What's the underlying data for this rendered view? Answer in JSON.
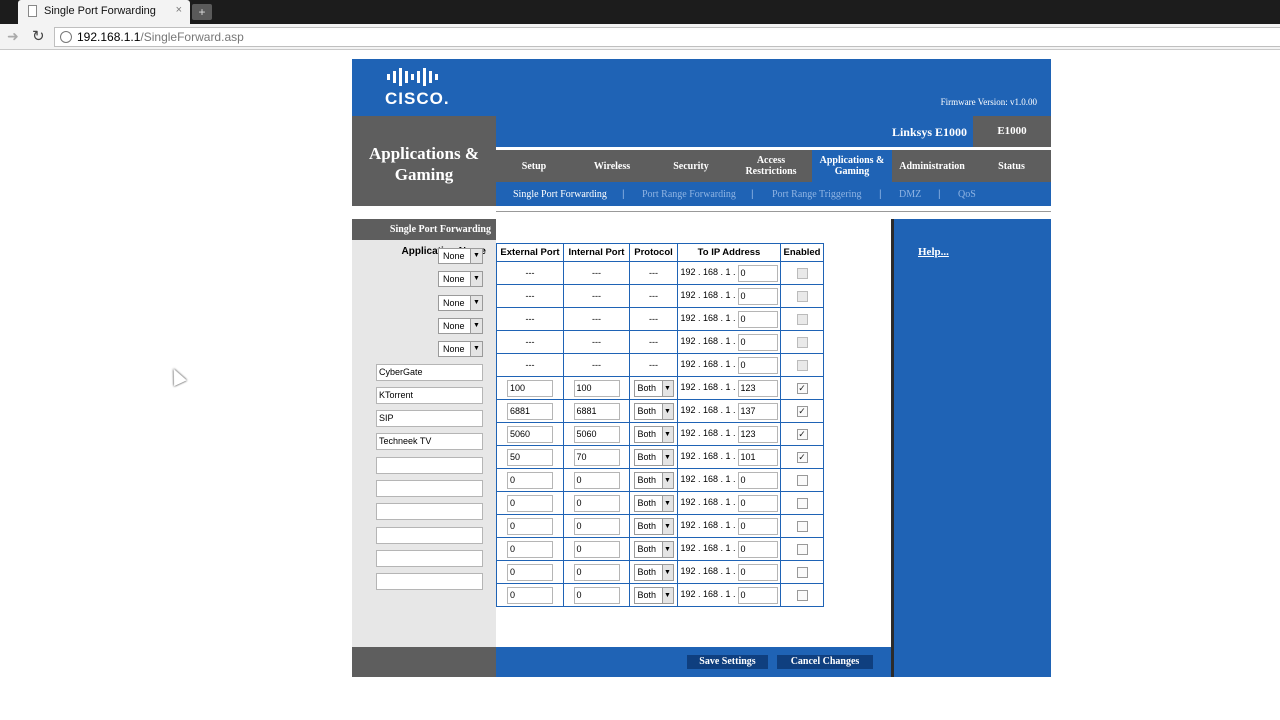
{
  "browser": {
    "tab_title": "Single Port Forwarding",
    "tab_close": "×",
    "new_tab": "+",
    "url_host": "192.168.1.1",
    "url_path": "/SingleForward.asp"
  },
  "header": {
    "brand": "CISCO.",
    "firmware": "Firmware Version: v1.0.00",
    "section_title_1": "Applications &",
    "section_title_2": "Gaming",
    "product_name": "Linksys E1000",
    "model": "E1000"
  },
  "menu": [
    {
      "label": "Setup"
    },
    {
      "label": "Wireless"
    },
    {
      "label": "Security"
    },
    {
      "label": "Access Restrictions"
    },
    {
      "label": "Applications & Gaming"
    },
    {
      "label": "Administration"
    },
    {
      "label": "Status"
    }
  ],
  "submenu": [
    {
      "label": "Single Port Forwarding"
    },
    {
      "label": "Port Range Forwarding"
    },
    {
      "label": "Port Range Triggering"
    },
    {
      "label": "DMZ"
    },
    {
      "label": "QoS"
    }
  ],
  "sidebar": {
    "title": "Single Port Forwarding",
    "app_name_label": "Application Name"
  },
  "table": {
    "headers": [
      "External Port",
      "Internal Port",
      "Protocol",
      "To IP Address",
      "Enabled"
    ],
    "ip_prefix": "192 . 168 . 1 .",
    "rows": [
      {
        "app": "None",
        "app_type": "select",
        "ext": "---",
        "int": "---",
        "proto": "---",
        "ip": "0",
        "enabled": false,
        "fixed": true
      },
      {
        "app": "None",
        "app_type": "select",
        "ext": "---",
        "int": "---",
        "proto": "---",
        "ip": "0",
        "enabled": false,
        "fixed": true
      },
      {
        "app": "None",
        "app_type": "select",
        "ext": "---",
        "int": "---",
        "proto": "---",
        "ip": "0",
        "enabled": false,
        "fixed": true
      },
      {
        "app": "None",
        "app_type": "select",
        "ext": "---",
        "int": "---",
        "proto": "---",
        "ip": "0",
        "enabled": false,
        "fixed": true
      },
      {
        "app": "None",
        "app_type": "select",
        "ext": "---",
        "int": "---",
        "proto": "---",
        "ip": "0",
        "enabled": false,
        "fixed": true
      },
      {
        "app": "CyberGate",
        "app_type": "input",
        "ext": "100",
        "int": "100",
        "proto": "Both",
        "ip": "123",
        "enabled": true,
        "fixed": false
      },
      {
        "app": "KTorrent",
        "app_type": "input",
        "ext": "6881",
        "int": "6881",
        "proto": "Both",
        "ip": "137",
        "enabled": true,
        "fixed": false
      },
      {
        "app": "SIP",
        "app_type": "input",
        "ext": "5060",
        "int": "5060",
        "proto": "Both",
        "ip": "123",
        "enabled": true,
        "fixed": false
      },
      {
        "app": "Techneek TV",
        "app_type": "input",
        "ext": "50",
        "int": "70",
        "proto": "Both",
        "ip": "101",
        "enabled": true,
        "fixed": false
      },
      {
        "app": "",
        "app_type": "input",
        "ext": "0",
        "int": "0",
        "proto": "Both",
        "ip": "0",
        "enabled": false,
        "fixed": false
      },
      {
        "app": "",
        "app_type": "input",
        "ext": "0",
        "int": "0",
        "proto": "Both",
        "ip": "0",
        "enabled": false,
        "fixed": false
      },
      {
        "app": "",
        "app_type": "input",
        "ext": "0",
        "int": "0",
        "proto": "Both",
        "ip": "0",
        "enabled": false,
        "fixed": false
      },
      {
        "app": "",
        "app_type": "input",
        "ext": "0",
        "int": "0",
        "proto": "Both",
        "ip": "0",
        "enabled": false,
        "fixed": false
      },
      {
        "app": "",
        "app_type": "input",
        "ext": "0",
        "int": "0",
        "proto": "Both",
        "ip": "0",
        "enabled": false,
        "fixed": false
      },
      {
        "app": "",
        "app_type": "input",
        "ext": "0",
        "int": "0",
        "proto": "Both",
        "ip": "0",
        "enabled": false,
        "fixed": false
      }
    ]
  },
  "help": {
    "label": "Help..."
  },
  "footer": {
    "save_label": "Save Settings",
    "cancel_label": "Cancel Changes"
  },
  "colors": {
    "brand_blue": "#1f63b5",
    "band_gray": "#5e5e5e",
    "button_navy": "#0f3f7f"
  }
}
